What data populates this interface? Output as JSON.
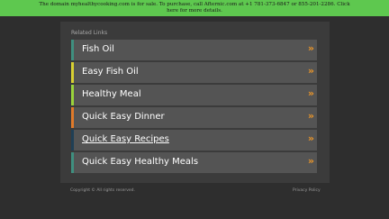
{
  "banner": {
    "line1": "The domain myhealthycooking.com is for sale. To purchase, call Afternic.com at +1 781-373-6847 or 855-201-2286. Click",
    "line2": "here for more details.",
    "color": "#5ec84f"
  },
  "related": {
    "title": "Related Links",
    "chevron": "»",
    "items": [
      {
        "label": "Fish Oil",
        "accent": "#3f8f7f"
      },
      {
        "label": "Easy Fish Oil",
        "accent": "#d8d032"
      },
      {
        "label": "Healthy Meal",
        "accent": "#9ad43b"
      },
      {
        "label": "Quick Easy Dinner",
        "accent": "#e07a2a"
      },
      {
        "label": "Quick Easy Recipes",
        "accent": "#1f3f55"
      },
      {
        "label": "Quick Easy Healthy Meals",
        "accent": "#3f8f7f"
      }
    ]
  },
  "footer": {
    "copyright": "Copyright ©  All rights reserved.",
    "privacy": "Privacy Policy"
  }
}
